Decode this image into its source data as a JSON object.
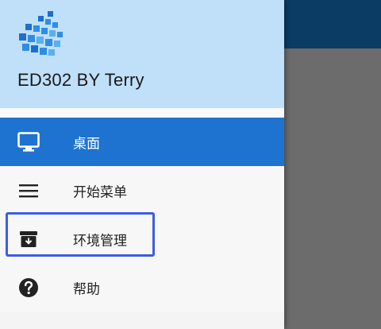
{
  "app": {
    "title": "ED302 BY Terry"
  },
  "colors": {
    "header_bg": "#bfe0f8",
    "active_item_bg": "#1e73d0",
    "highlight_border": "#3c5de0",
    "scrim": "#6c6c6c",
    "toolbar": "#0b3c63"
  },
  "menu": {
    "items": [
      {
        "label": "桌面",
        "icon": "monitor-icon",
        "active": true
      },
      {
        "label": "开始菜单",
        "icon": "hamburger-menu-icon",
        "active": false
      },
      {
        "label": "环境管理",
        "icon": "archive-download-icon",
        "active": false
      },
      {
        "label": "帮助",
        "icon": "help-circle-icon",
        "active": false
      }
    ]
  }
}
